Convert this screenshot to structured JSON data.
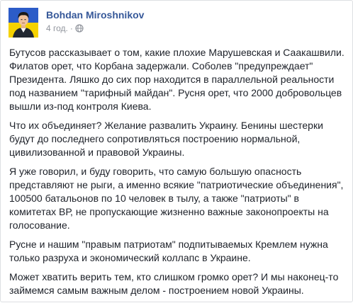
{
  "post": {
    "author": "Bohdan Miroshnikov",
    "timestamp": "4 год.",
    "separator": "·",
    "privacy_icon": "globe-icon",
    "avatar_icon": "avatar-ukraine-flag-icon",
    "colors": {
      "author": "#365899",
      "meta": "#90949c",
      "text": "#1d2129",
      "flag_blue": "#2c5cc8",
      "flag_yellow": "#f5d200"
    },
    "paragraphs": [
      "Бутусов рассказывает о том, какие плохие Марушевская и Саакашвили. Филатов орет, что Корбана задержали. Соболев \"предупреждает\" Президента. Ляшко до сих пор находится в параллельной реальности под названием \"тарифный майдан\". Русня орет, что 2000 добровольцев вышли из-под контроля Киева.",
      "Что их объединяет? Желание развалить Украину. Бенины шестерки будут до последнего сопротивляться построению нормальной, цивилизованной и правовой Украины.",
      "Я уже говорил, и буду говорить, что самую большую опасность представляют не рыги, а именно всякие \"патриотические объединения\", 100500 батальонов по 10 человек в тылу, а также \"патриоты\" в комитетах ВР, не пропускающие жизненно важные законопроекты на голосование.",
      "Русне и нашим \"правым патриотам\" подпитываемых Кремлем нужна только разруха и экономический коллапс в Украине.",
      "Может хватить верить тем, кто слишком громко орет? И мы наконец-то займемся самым важным делом - построением новой Украины."
    ]
  }
}
